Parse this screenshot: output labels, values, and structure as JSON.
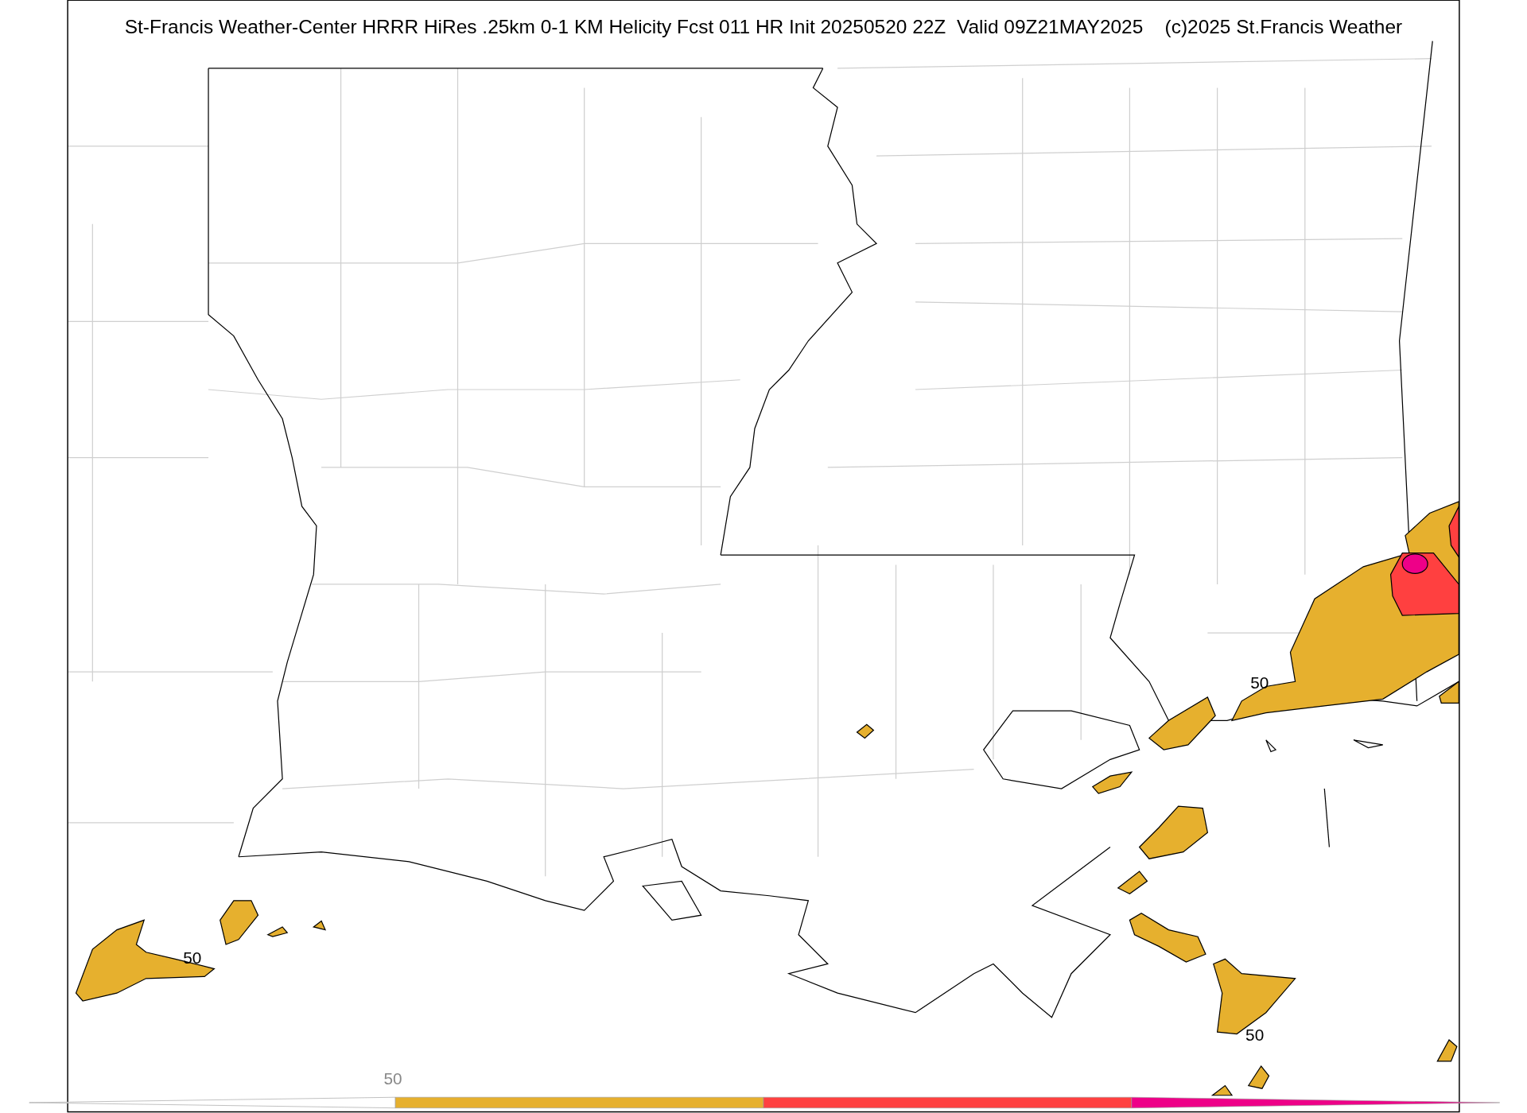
{
  "title": "St-Francis Weather-Center HRRR HiRes .25km 0-1 KM Helicity Fcst 011 HR Init 20250520 22Z  Valid 09Z21MAY2025    (c)2025 St.Francis Weather",
  "contour_labels": [
    "50",
    "50",
    "50"
  ],
  "colorbar": {
    "tick_label": "50",
    "segments": [
      {
        "color": "#ffffff"
      },
      {
        "color": "#e6b02e"
      },
      {
        "color": "#ff4040"
      },
      {
        "color": "#ee0088"
      }
    ]
  }
}
